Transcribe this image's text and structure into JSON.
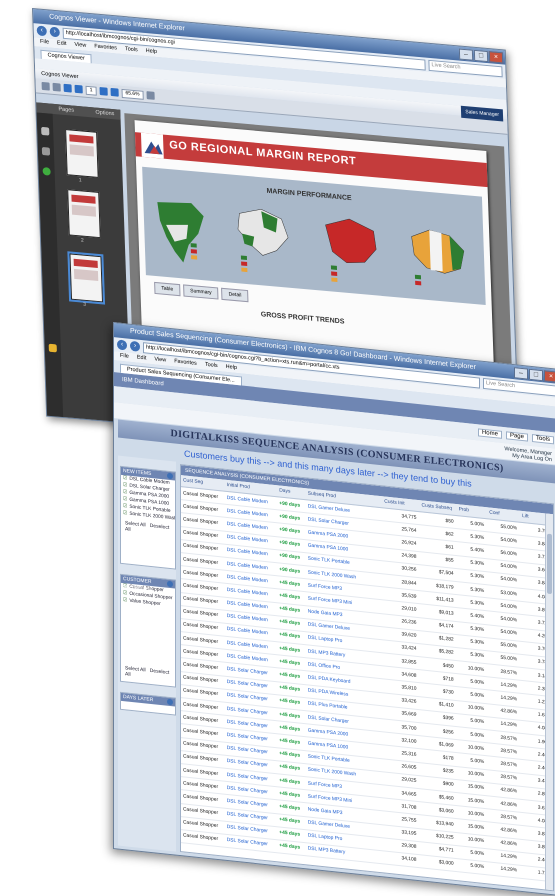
{
  "back_window": {
    "title": "Cognos Viewer - Windows Internet Explorer",
    "url": "http://localhost/ibmcognos/cgi-bin/cognos.cgi",
    "search_placeholder": "Live Search",
    "menu": [
      "File",
      "Edit",
      "View",
      "Favorites",
      "Tools",
      "Help"
    ],
    "tab": "Cognos Viewer",
    "app_tab": "Cognos Viewer",
    "user": "Sales Manager",
    "zoom": "65.6%",
    "page_of": "1",
    "pages_panel": "Pages",
    "options": "Options",
    "page_numbers": [
      "1",
      "2",
      "3"
    ],
    "report": {
      "title": "GO REGIONAL MARGIN REPORT",
      "section": "MARGIN PERFORMANCE",
      "section2": "GROSS PROFIT TRENDS",
      "tabs": [
        "Table",
        "Summary",
        "Detail"
      ]
    }
  },
  "front_window": {
    "title": "Product Sales Sequencing (Consumer Electronics) - IBM Cognos 8 Go! Dashboard - Windows Internet Explorer",
    "url": "http://localhost/ibmcognos/cgi-bin/cognos.cgi?b_action=xts.run&m=portal/cc.xts",
    "menu": [
      "File",
      "Edit",
      "View",
      "Favorites",
      "Tools",
      "Help"
    ],
    "tab": "Product Sales Sequencing (Consumer Ele...",
    "app_name": "IBM Dashboard",
    "toolbar": [
      "Home",
      "Page",
      "Tools"
    ],
    "user_line1": "Welcome, Manager",
    "user_line2": "My Area  Log On",
    "banner": "DIGITALKISS SEQUENCE ANALYSIS (CONSUMER ELECTRONICS)",
    "subline": "Customers buy this --> and this many days later --> they tend to buy this",
    "left_panel": {
      "box1_title": "NEW ITEMS",
      "box1_items": [
        "DSL Cable Modem",
        "DSL Solar Charger",
        "Gamma PSA 2000",
        "Gamma PSA 1000",
        "Sonic TLK Portable",
        "Sonic TLK 2000 Wash"
      ],
      "select_all": "Select All",
      "deselect_all": "Deselect All",
      "box2_title": "CUSTOMER SEGMENTS",
      "box2_items": [
        "Casual Shopper",
        "Occasional Shopper",
        "Value Shopper"
      ],
      "box3_title": "DAYS LATER"
    },
    "grid": {
      "head": "SEQUENCE ANALYSIS (CONSUMER ELECTRONICS)",
      "columns": [
        "Cust Seg",
        "Initial Prod",
        "Days",
        "Subseq Prod",
        "Custs Init",
        "Custs Subseq",
        "Prob",
        "Conf",
        "Lift"
      ],
      "rows": [
        [
          "Casual Shopper",
          "DSL Cable Modem",
          "+90 days",
          "DSL Gamer Deluxe",
          "34,775",
          "$50",
          "5.00%",
          "55.00%",
          "3.750"
        ],
        [
          "Casual Shopper",
          "DSL Cable Modem",
          "+90 days",
          "DSL Solar Charger",
          "25,764",
          "$62",
          "5.30%",
          "54.00%",
          "3.844"
        ],
        [
          "Casual Shopper",
          "DSL Cable Modem",
          "+90 days",
          "Gamma PSA 2000",
          "26,924",
          "$61",
          "5.40%",
          "56.00%",
          "3.710"
        ],
        [
          "Casual Shopper",
          "DSL Cable Modem",
          "+90 days",
          "Gamma PSA 1000",
          "24,398",
          "$55",
          "5.30%",
          "54.00%",
          "3.660"
        ],
        [
          "Casual Shopper",
          "DSL Cable Modem",
          "+90 days",
          "Sonic TLK Portable",
          "30,256",
          "$7,504",
          "5.30%",
          "54.00%",
          "3.846"
        ],
        [
          "Casual Shopper",
          "DSL Cable Modem",
          "+90 days",
          "Sonic TLK 2000 Wash",
          "28,844",
          "$18,179",
          "5.30%",
          "53.00%",
          "4.085"
        ],
        [
          "Casual Shopper",
          "DSL Cable Modem",
          "+45 days",
          "Surf Force MP3",
          "35,539",
          "$11,413",
          "5.30%",
          "54.00%",
          "3.896"
        ],
        [
          "Casual Shopper",
          "DSL Cable Modem",
          "+45 days",
          "Surf Force MP3 Mini",
          "29,010",
          "$9,013",
          "5.40%",
          "54.00%",
          "3.723"
        ],
        [
          "Casual Shopper",
          "DSL Cable Modem",
          "+45 days",
          "Node Gaia MP3",
          "26,236",
          "$4,174",
          "5.30%",
          "54.00%",
          "4.206"
        ],
        [
          "Casual Shopper",
          "DSL Cable Modem",
          "+45 days",
          "DSL Gamer Deluxe",
          "39,620",
          "$1,282",
          "5.30%",
          "55.00%",
          "3.701"
        ],
        [
          "Casual Shopper",
          "DSL Cable Modem",
          "+45 days",
          "DSL Laptop Pro",
          "33,424",
          "$5,282",
          "5.30%",
          "55.00%",
          "3.785"
        ],
        [
          "Casual Shopper",
          "DSL Cable Modem",
          "+45 days",
          "DSL MP3 Battery",
          "32,855",
          "$450",
          "10.00%",
          "28.57%",
          "3.141"
        ],
        [
          "Casual Shopper",
          "DSL Cable Modem",
          "+45 days",
          "DSL Office Pro",
          "34,608",
          "$718",
          "5.00%",
          "14.29%",
          "2.356"
        ],
        [
          "Casual Shopper",
          "DSL Solar Charger",
          "+45 days",
          "DSL PDA Keyboard",
          "35,810",
          "$730",
          "5.00%",
          "14.29%",
          "1.224"
        ],
        [
          "Casual Shopper",
          "DSL Solar Charger",
          "+45 days",
          "DSL PDA Wireless",
          "33,426",
          "$1,410",
          "10.00%",
          "42.86%",
          "1.635"
        ],
        [
          "Casual Shopper",
          "DSL Solar Charger",
          "+45 days",
          "DSL Plus Portable",
          "35,669",
          "$396",
          "5.00%",
          "14.29%",
          "4.086"
        ],
        [
          "Casual Shopper",
          "DSL Solar Charger",
          "+45 days",
          "DSL Solar Charger",
          "35,700",
          "$256",
          "5.00%",
          "28.57%",
          "1.905"
        ],
        [
          "Casual Shopper",
          "DSL Solar Charger",
          "+45 days",
          "Gamma PSA 2000",
          "32,100",
          "$1,069",
          "10.00%",
          "28.57%",
          "2.461"
        ],
        [
          "Casual Shopper",
          "DSL Solar Charger",
          "+45 days",
          "Gamma PSA 1000",
          "25,316",
          "$178",
          "5.00%",
          "28.57%",
          "2.461"
        ],
        [
          "Casual Shopper",
          "DSL Solar Charger",
          "+45 days",
          "Sonic TLK Portable",
          "26,605",
          "$235",
          "10.00%",
          "28.57%",
          "3.430"
        ],
        [
          "Casual Shopper",
          "DSL Solar Charger",
          "+45 days",
          "Sonic TLK 2000 Wash",
          "29,025",
          "$900",
          "15.00%",
          "42.86%",
          "2.857"
        ],
        [
          "Casual Shopper",
          "DSL Solar Charger",
          "+45 days",
          "Surf Force MP3",
          "34,665",
          "$5,460",
          "15.00%",
          "42.86%",
          "3.627"
        ],
        [
          "Casual Shopper",
          "DSL Solar Charger",
          "+45 days",
          "Surf Force MP3 Mini",
          "31,708",
          "$3,060",
          "10.00%",
          "28.57%",
          "4.086"
        ],
        [
          "Casual Shopper",
          "DSL Solar Charger",
          "+45 days",
          "Node Gaia MP3",
          "25,755",
          "$13,940",
          "15.00%",
          "42.86%",
          "3.837"
        ],
        [
          "Casual Shopper",
          "DSL Solar Charger",
          "+45 days",
          "DSL Gamer Deluxe",
          "33,195",
          "$10,225",
          "10.00%",
          "42.86%",
          "3.857"
        ],
        [
          "Casual Shopper",
          "DSL Solar Charger",
          "+45 days",
          "DSL Laptop Pro",
          "29,308",
          "$4,771",
          "5.00%",
          "14.29%",
          "2.463"
        ],
        [
          "Casual Shopper",
          "DSL Solar Charger",
          "+45 days",
          "DSL MP3 Battery",
          "34,108",
          "$3,000",
          "5.00%",
          "14.29%",
          "1.714"
        ]
      ]
    }
  },
  "colors": {
    "report_red": "#c43c3c",
    "dashboard_blue": "#6f86b3",
    "link_blue": "#2d5fd0",
    "days_green": "#169a3a"
  }
}
